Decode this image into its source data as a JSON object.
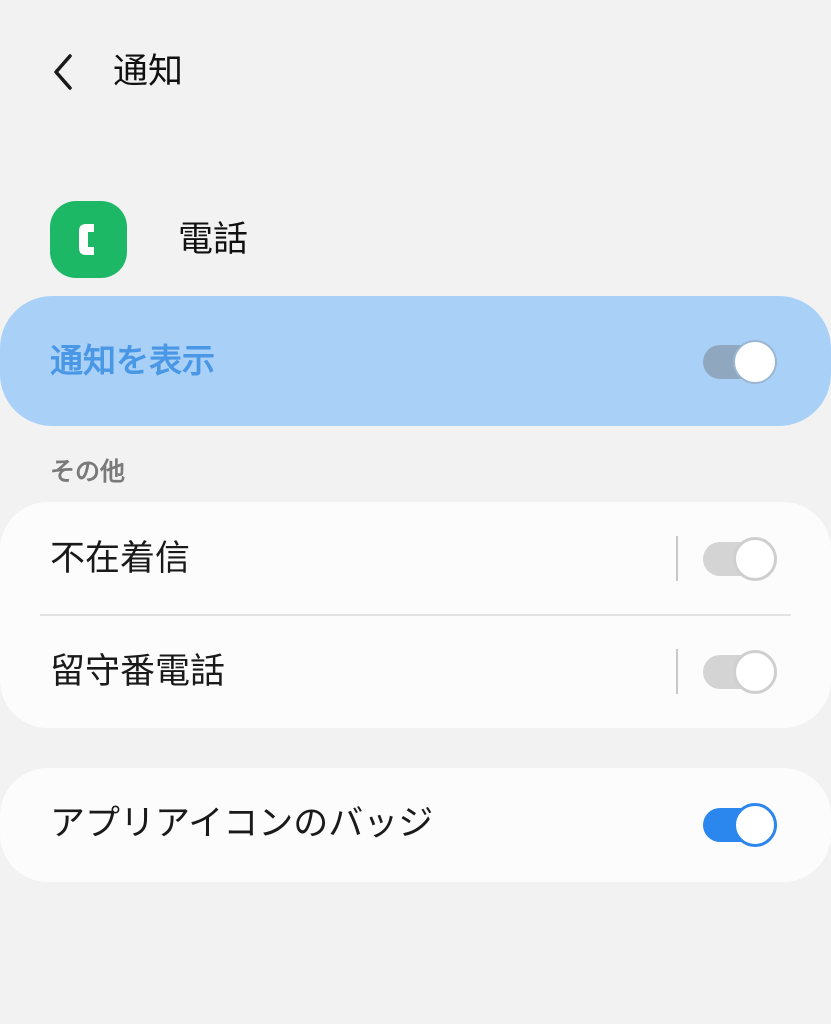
{
  "header": {
    "title": "通知",
    "back_icon": "chevron-left-icon"
  },
  "app": {
    "name": "電話",
    "icon": "phone-app-icon",
    "icon_color": "#1db866"
  },
  "master_toggle": {
    "label": "通知を表示",
    "state": "on",
    "highlight_color": "#a9d1f8"
  },
  "section": {
    "title": "その他",
    "items": [
      {
        "label": "不在着信",
        "state": "off"
      },
      {
        "label": "留守番電話",
        "state": "off"
      }
    ]
  },
  "badge": {
    "label": "アプリアイコンのバッジ",
    "state": "on",
    "accent_color": "#2b86ee"
  }
}
